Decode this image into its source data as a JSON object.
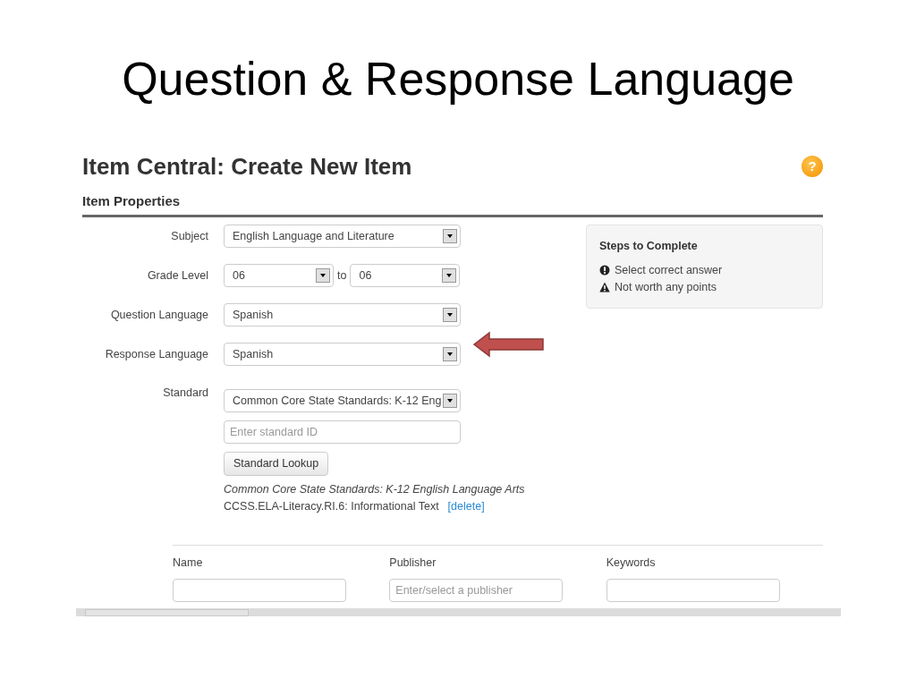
{
  "slide": {
    "title": "Question & Response Language"
  },
  "page": {
    "title": "Item Central: Create New Item",
    "help": "?",
    "section": "Item Properties"
  },
  "fields": [
    {
      "label": "Subject",
      "kind": "select",
      "value": "English Language and Literature"
    },
    {
      "label": "Grade Level",
      "kind": "range",
      "value": "06",
      "joiner": "to",
      "value_to": "06"
    },
    {
      "label": "Question Language",
      "kind": "select",
      "value": "Spanish"
    },
    {
      "label": "Response Language",
      "kind": "select",
      "value": "Spanish"
    }
  ],
  "standard": {
    "label": "Standard",
    "value": "Common Core State Standards: K-12 Eng",
    "placeholder": "Enter standard ID",
    "button": "Standard Lookup",
    "framework": "Common Core State Standards: K-12 English Language Arts",
    "code": "CCSS.ELA-Literacy.RI.6: Informational Text",
    "delete_link": "[delete]"
  },
  "steps": {
    "title": "Steps to Complete",
    "items": [
      {
        "kind": "error",
        "text": "Select correct answer"
      },
      {
        "kind": "warning",
        "text": "Not worth any points"
      }
    ]
  },
  "bottom_fields": [
    {
      "label": "Name"
    },
    {
      "label": "Publisher",
      "placeholder": "Enter/select a publisher"
    },
    {
      "label": "Keywords"
    }
  ]
}
